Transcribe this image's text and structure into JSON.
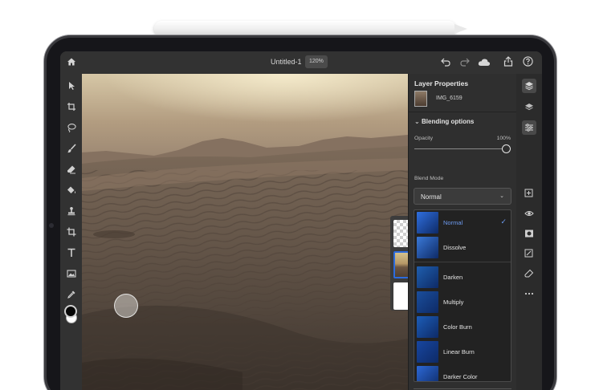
{
  "document": {
    "title": "Untitled-1",
    "zoom": "120%"
  },
  "properties": {
    "title": "Layer Properties",
    "layer_name": "IMG_6159",
    "section": "Blending options",
    "opacity_label": "Opacity",
    "opacity_value": "100%",
    "opacity_fraction": 1.0,
    "blend_mode_label": "Blend Mode",
    "blend_mode_value": "Normal",
    "blend_modes": [
      {
        "name": "Normal",
        "selected": true,
        "swatch": "#2f6fe0"
      },
      {
        "name": "Dissolve",
        "selected": false,
        "swatch": "#3a79d8"
      },
      {
        "name": "Darken",
        "selected": false,
        "swatch": "#1f5fae"
      },
      {
        "name": "Multiply",
        "selected": false,
        "swatch": "#1a4e9c"
      },
      {
        "name": "Color Burn",
        "selected": false,
        "swatch": "#1c5db8"
      },
      {
        "name": "Linear Burn",
        "selected": false,
        "swatch": "#1746a0"
      },
      {
        "name": "Darker Color",
        "selected": false,
        "swatch": "#2c68d6"
      }
    ]
  },
  "left_tools": [
    "select-icon",
    "transform-icon",
    "lasso-icon",
    "brush-icon",
    "eraser-icon",
    "fill-icon",
    "clone-stamp-icon",
    "crop-icon",
    "type-icon",
    "place-image-icon",
    "eyedropper-icon"
  ],
  "right_tools": [
    "layers-icon",
    "layer-properties-icon",
    "adjustments-icon",
    "add-layer-icon",
    "visibility-icon",
    "mask-icon",
    "adjustment-layer-icon",
    "clear-icon",
    "more-icon"
  ],
  "colors": {
    "accent": "#2c6bde",
    "panel": "#2f2f2f",
    "toolbar": "#323232",
    "foreground_color": "#060606",
    "background_color": "#ffffff"
  }
}
